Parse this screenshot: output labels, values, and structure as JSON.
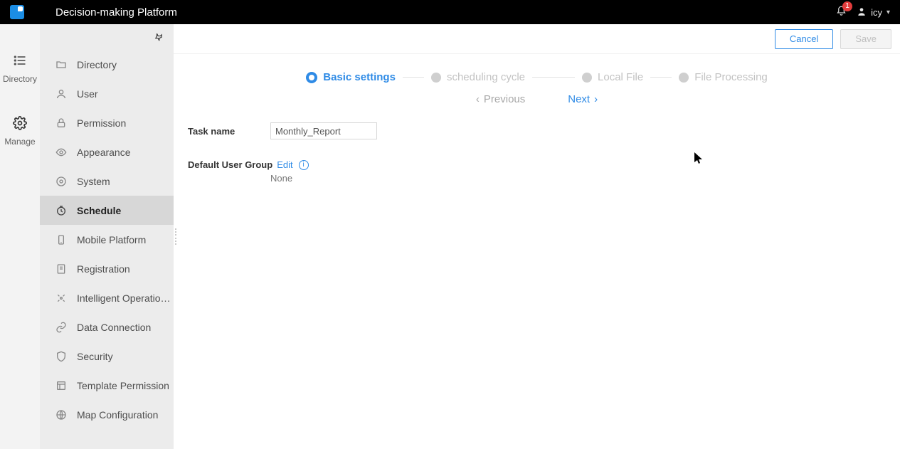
{
  "header": {
    "title": "Decision-making Platform",
    "notification_badge": "1",
    "username": "icy"
  },
  "rail": {
    "items": [
      {
        "label": "Directory"
      },
      {
        "label": "Manage"
      }
    ]
  },
  "sidebar": {
    "items": [
      {
        "label": "Directory"
      },
      {
        "label": "User"
      },
      {
        "label": "Permission"
      },
      {
        "label": "Appearance"
      },
      {
        "label": "System"
      },
      {
        "label": "Schedule"
      },
      {
        "label": "Mobile Platform"
      },
      {
        "label": "Registration"
      },
      {
        "label": "Intelligent Operatio…"
      },
      {
        "label": "Data Connection"
      },
      {
        "label": "Security"
      },
      {
        "label": "Template Permission"
      },
      {
        "label": "Map Configuration"
      }
    ]
  },
  "actions": {
    "cancel": "Cancel",
    "save": "Save"
  },
  "stepper": {
    "steps": [
      {
        "label": "Basic settings"
      },
      {
        "label": "scheduling cycle"
      },
      {
        "label": "Local File"
      },
      {
        "label": "File Processing"
      }
    ]
  },
  "nav": {
    "previous": "Previous",
    "next": "Next"
  },
  "form": {
    "task_name_label": "Task name",
    "task_name_value": "Monthly_Report",
    "default_user_group_label": "Default User Group",
    "edit_label": "Edit",
    "none_value": "None"
  }
}
